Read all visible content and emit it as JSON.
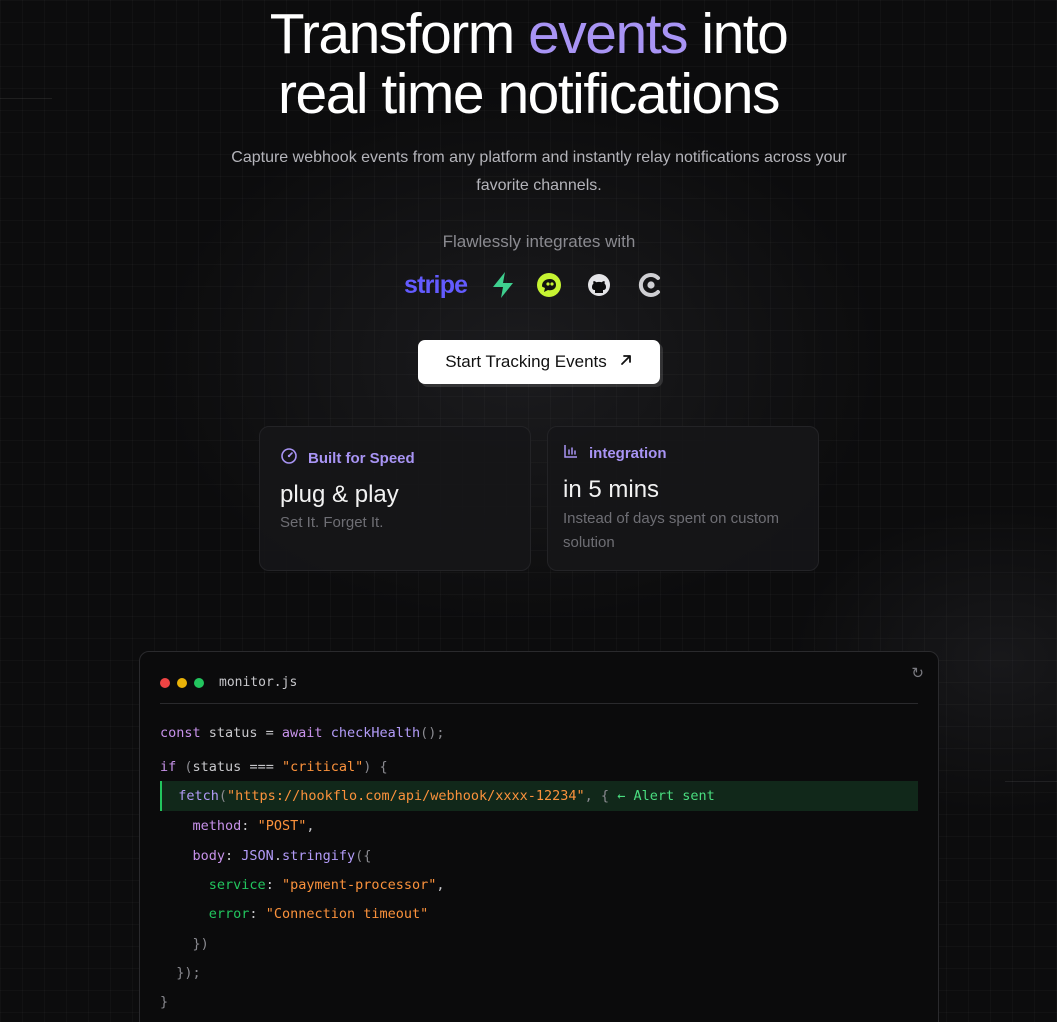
{
  "hero": {
    "title_part1": "Transform ",
    "title_accent": "events",
    "title_part2": " into",
    "title_line2": "real time notifications",
    "subtitle": "Capture webhook events from any platform and instantly relay notifications across your favorite channels."
  },
  "integrations": {
    "label": "Flawlessly integrates with",
    "stripe": "stripe",
    "icons": [
      "supabase-icon",
      "chatbot-icon",
      "github-icon",
      "clerk-icon"
    ]
  },
  "cta": {
    "label": "Start Tracking Events",
    "icon": "arrow-up-right-icon"
  },
  "cards": {
    "speed": {
      "heading": "Built for Speed",
      "title": "plug & play",
      "desc": "Set It. Forget It."
    },
    "integration": {
      "heading": "integration",
      "title": "in 5 mins",
      "desc": "Instead of days spent on custom solution"
    }
  },
  "code_window": {
    "filename": "monitor.js",
    "refresh_icon": "↻",
    "alert_note": "← Alert sent",
    "strings": {
      "critical": "\"critical\"",
      "url": "\"https://hookflo.com/api/webhook/xxxx-12234\"",
      "method": "\"POST\"",
      "service": "\"payment-processor\"",
      "error": "\"Connection timeout\""
    }
  },
  "colors": {
    "background": "#0c0c0d",
    "accent": "#a894f4",
    "stripe": "#635bff",
    "supabase": "#3ecf8e",
    "highlight": "#22c55e"
  }
}
